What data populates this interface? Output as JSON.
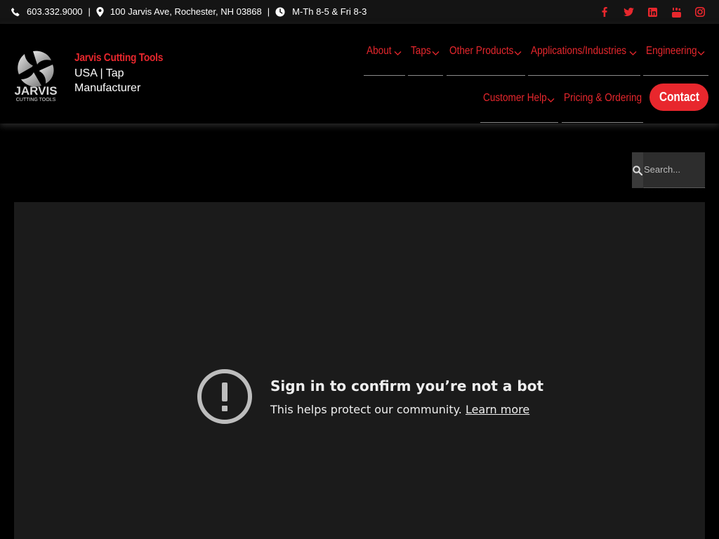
{
  "topbar": {
    "phone": "603.332.9000",
    "address": "100 Jarvis Ave, Rochester, NH 03868",
    "hours": "M-Th 8-5 & Fri 8-3",
    "separator": "|",
    "social_icons": [
      "facebook-icon",
      "twitter-icon",
      "linkedin-icon",
      "youtube-icon",
      "instagram-icon"
    ]
  },
  "brand": {
    "logo_text": "JARVIS",
    "logo_subtext": "CUTTING TOOLS",
    "name": "Jarvis Cutting Tools",
    "tagline_line1": "USA | Tap",
    "tagline_line2": "Manufacturer"
  },
  "nav": {
    "items": [
      {
        "label": "About"
      },
      {
        "label": "Taps"
      },
      {
        "label": "Other Products"
      },
      {
        "label": "Applications/Industries"
      },
      {
        "label": "Engineering"
      },
      {
        "label": "Customer Help"
      },
      {
        "label": "Pricing & Ordering"
      }
    ],
    "contact_label": "Contact"
  },
  "search": {
    "placeholder": "Search..."
  },
  "video": {
    "title": "Sign in to confirm you’re not a bot",
    "subtitle": "This helps protect our community.",
    "link": "Learn more"
  },
  "colors": {
    "accent": "#e8272d",
    "background": "#000000",
    "topbar": "#141414",
    "video_bg": "#1b1b1b"
  }
}
